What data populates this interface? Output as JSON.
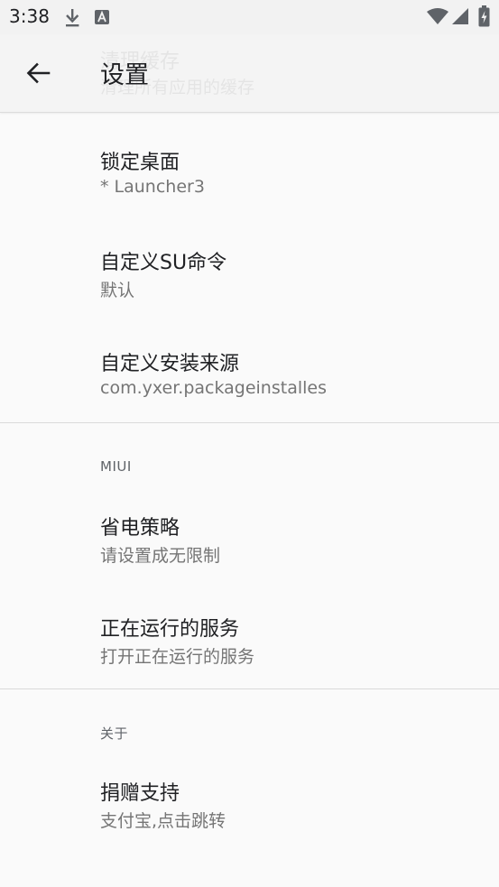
{
  "status_bar": {
    "time": "3:38",
    "icons": [
      "download-icon",
      "font-icon",
      "wifi-icon",
      "signal-icon",
      "battery-charging-icon"
    ]
  },
  "app_bar": {
    "title": "设置",
    "back_icon": "arrow-back-icon",
    "ghost_title": "清理缓存",
    "ghost_summary": "清理所有应用的缓存"
  },
  "general": {
    "items": [
      {
        "title": "锁定桌面",
        "summary": "* Launcher3"
      },
      {
        "title": "自定义SU命令",
        "summary": "默认"
      },
      {
        "title": "自定义安装来源",
        "summary": "com.yxer.packageinstalles"
      }
    ]
  },
  "miui": {
    "header": "MIUI",
    "items": [
      {
        "title": "省电策略",
        "summary": "请设置成无限制"
      },
      {
        "title": "正在运行的服务",
        "summary": "打开正在运行的服务"
      }
    ]
  },
  "about": {
    "header": "关于",
    "items": [
      {
        "title": "捐赠支持",
        "summary": "支付宝,点击跳转"
      }
    ]
  },
  "colors": {
    "background": "#fafafa",
    "primary_text": "#202124",
    "secondary_text": "#757575",
    "divider": "#dadada"
  }
}
